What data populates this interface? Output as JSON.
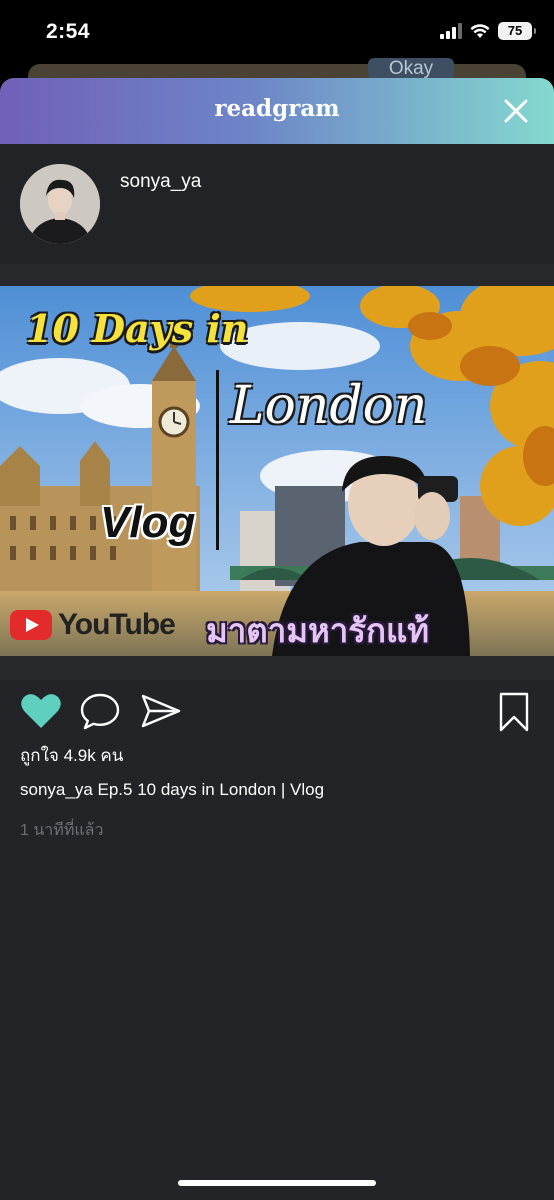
{
  "status_bar": {
    "time": "2:54",
    "battery": "75"
  },
  "background": {
    "okay_label": "Okay"
  },
  "header": {
    "title": "readgram"
  },
  "post": {
    "username": "sonya_ya",
    "thumbnail": {
      "title": "10 Days in",
      "city": "London",
      "vlog": "Vlog",
      "youtube": "YouTube",
      "thai_text": "มาตามหารักแท้"
    },
    "likes_text": "ถูกใจ 4.9k คน",
    "caption_user": "sonya_ya",
    "caption_text": "Ep.5 10 days in London | Vlog",
    "timestamp": "1 นาทีที่แล้ว"
  },
  "colors": {
    "like": "#5fcfbf",
    "header_gradient_start": "#7160b8",
    "header_gradient_end": "#84d8cf",
    "modal_bg": "#232428"
  },
  "icons": {
    "like": "heart-icon",
    "comment": "speech-bubble-icon",
    "share": "paper-plane-icon",
    "bookmark": "bookmark-icon",
    "close": "close-icon"
  }
}
